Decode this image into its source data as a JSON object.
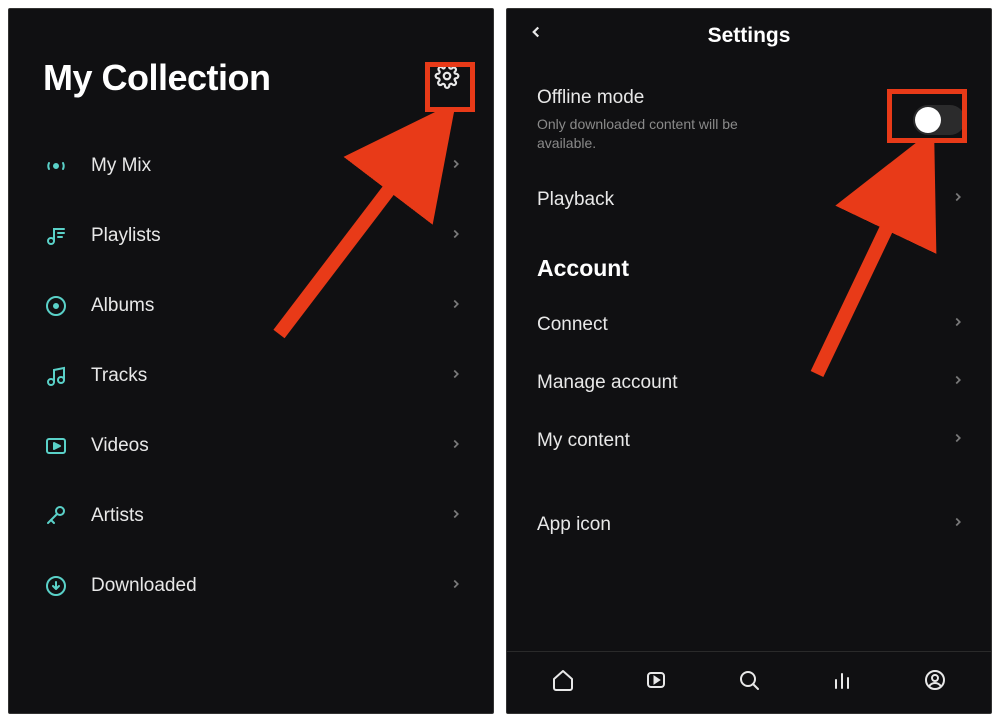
{
  "left": {
    "title": "My Collection",
    "items": [
      {
        "label": "My Mix"
      },
      {
        "label": "Playlists"
      },
      {
        "label": "Albums"
      },
      {
        "label": "Tracks"
      },
      {
        "label": "Videos"
      },
      {
        "label": "Artists"
      },
      {
        "label": "Downloaded"
      }
    ]
  },
  "right": {
    "title": "Settings",
    "offline": {
      "title": "Offline mode",
      "desc": "Only downloaded content will be available.",
      "value": false
    },
    "row_playback": "Playback",
    "section_account": "Account",
    "row_connect": "Connect",
    "row_manage": "Manage account",
    "row_mycontent": "My content",
    "row_appicon": "App icon"
  }
}
